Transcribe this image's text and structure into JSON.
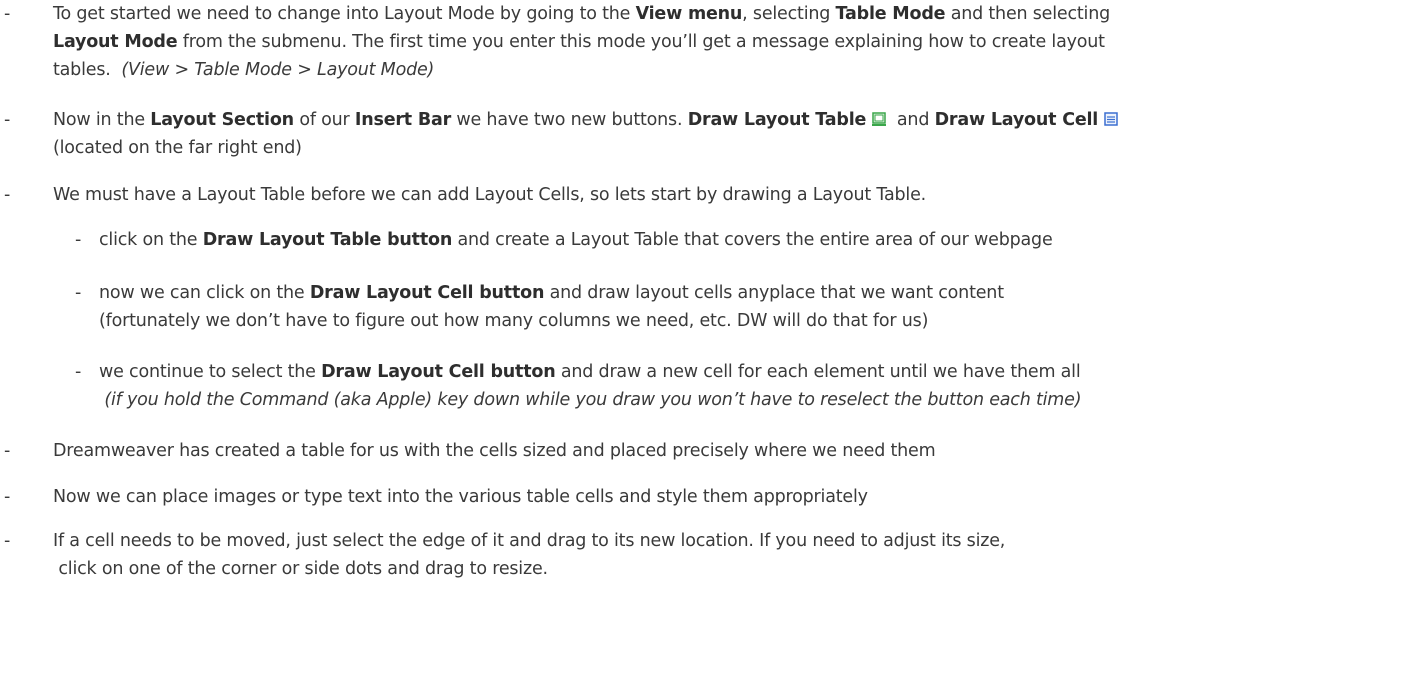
{
  "bullet": "-",
  "items": [
    {
      "lines": [
        [
          {
            "t": "To get started we need to change into Layout Mode by going to the "
          },
          {
            "t": "View menu",
            "b": true
          },
          {
            "t": ", selecting "
          },
          {
            "t": "Table Mode",
            "b": true
          },
          {
            "t": " and then selecting"
          }
        ],
        [
          {
            "t": "Layout Mode",
            "b": true
          },
          {
            "t": " from the submenu. The first time you enter this mode you’ll get a message explaining how to create layout"
          }
        ],
        [
          {
            "t": "tables.  "
          },
          {
            "t": "(View > Table Mode > Layout Mode)",
            "i": true
          }
        ]
      ]
    },
    {
      "lines": [
        [
          {
            "t": "Now in the "
          },
          {
            "t": "Layout Section",
            "b": true
          },
          {
            "t": " of our "
          },
          {
            "t": "Insert Bar",
            "b": true
          },
          {
            "t": " we have two new buttons. "
          },
          {
            "t": "Draw Layout Table",
            "b": true
          },
          {
            "icon": "draw-layout-table-icon"
          },
          {
            "t": "  and "
          },
          {
            "t": "Draw Layout Cell",
            "b": true
          },
          {
            "icon": "draw-layout-cell-icon"
          }
        ],
        [
          {
            "t": "(located on the far right end)"
          }
        ]
      ]
    },
    {
      "lines": [
        [
          {
            "t": "We must have a Layout Table before we can add Layout Cells, so lets start by drawing a Layout Table."
          }
        ]
      ]
    },
    {
      "level": 2,
      "lines": [
        [
          {
            "t": "click on the "
          },
          {
            "t": "Draw Layout Table button",
            "b": true
          },
          {
            "t": " and create a Layout Table that covers the entire area of our webpage"
          }
        ]
      ]
    },
    {
      "level": 2,
      "lines": [
        [
          {
            "t": "now we can click on the "
          },
          {
            "t": "Draw Layout Cell button",
            "b": true
          },
          {
            "t": " and draw layout cells anyplace that we want content"
          }
        ],
        [
          {
            "t": "(fortunately we don’t have to figure out how many columns we need, etc. DW will do that for us)"
          }
        ]
      ]
    },
    {
      "level": 2,
      "lines": [
        [
          {
            "t": "we continue to select the "
          },
          {
            "t": "Draw Layout Cell button",
            "b": true
          },
          {
            "t": " and draw a new cell for each element until we have them all"
          }
        ],
        [
          {
            "t": " (if you hold the Command (aka Apple) key down while you draw you won’t have to reselect the button each time)",
            "i": true
          }
        ]
      ]
    },
    {
      "lines": [
        [
          {
            "t": "Dreamweaver has created a table for us with the cells sized and placed precisely where we need them"
          }
        ]
      ]
    },
    {
      "lines": [
        [
          {
            "t": "Now we can place images or type text into the various table cells and style them appropriately"
          }
        ]
      ]
    },
    {
      "lines": [
        [
          {
            "t": "If a cell needs to be moved, just select the edge of it and drag to its new location. If you need to adjust its size,"
          }
        ],
        [
          {
            "t": " click on one of the corner or side dots and drag to resize."
          }
        ]
      ]
    }
  ],
  "colors": {
    "text": "#3a3a3a",
    "icon_green": "#3aa64a",
    "icon_blue": "#3b6fd1"
  }
}
